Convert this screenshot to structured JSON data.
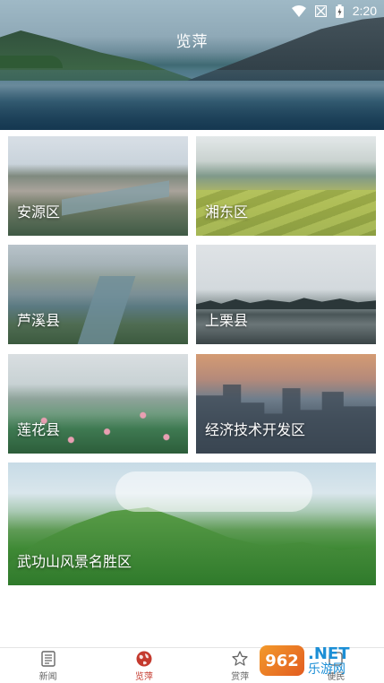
{
  "status_bar": {
    "time": "2:20"
  },
  "header": {
    "title": "览萍"
  },
  "tiles": [
    {
      "label": "安源区"
    },
    {
      "label": "湘东区"
    },
    {
      "label": "芦溪县"
    },
    {
      "label": "上栗县"
    },
    {
      "label": "莲花县"
    },
    {
      "label": "经济技术开发区"
    },
    {
      "label": "武功山风景名胜区"
    }
  ],
  "bottom_nav": {
    "active_color": "#c43a2e",
    "items": [
      {
        "label": "新闻",
        "icon": "newspaper-icon"
      },
      {
        "label": "览萍",
        "icon": "globe-icon"
      },
      {
        "label": "赏萍",
        "icon": "star-icon"
      },
      {
        "label": "便民",
        "icon": "service-icon"
      }
    ]
  },
  "watermark": {
    "logo_text": "962",
    "domain": ".NET",
    "site_name": "乐游网"
  }
}
